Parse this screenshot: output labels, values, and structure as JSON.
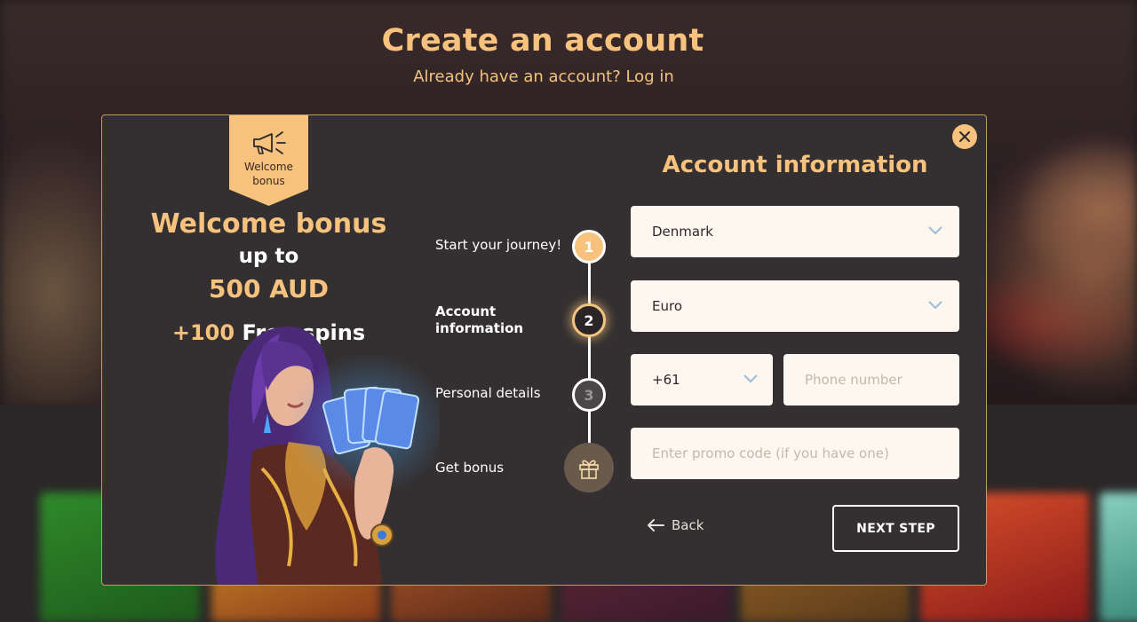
{
  "page": {
    "title": "Create an account",
    "login_prompt": "Already have an account? Log in"
  },
  "promo": {
    "ribbon_text": "Welcome bonus",
    "title": "Welcome bonus",
    "up_to": "up to",
    "amount": "500 AUD",
    "spins_count": "+100",
    "spins_text": "Free spins"
  },
  "steps": [
    {
      "label": "Start your journey!",
      "number": "1"
    },
    {
      "label": "Account information",
      "number": "2"
    },
    {
      "label": "Personal details",
      "number": "3"
    },
    {
      "label": "Get bonus",
      "icon": "gift-icon"
    }
  ],
  "form": {
    "title": "Account information",
    "country": "Denmark",
    "currency": "Euro",
    "phone_code": "+61",
    "phone_placeholder": "Phone number",
    "promo_placeholder": "Enter promo code (if you have one)",
    "back_label": "Back",
    "next_label": "NEXT STEP"
  },
  "colors": {
    "accent": "#f6c27d",
    "modal_bg": "#343031",
    "field_bg": "#fdf7ef"
  }
}
